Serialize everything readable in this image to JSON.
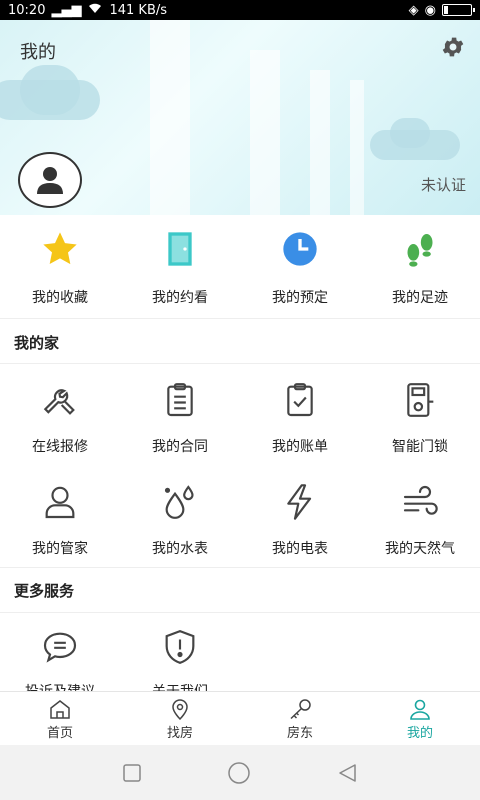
{
  "status_bar": {
    "time": "10:20",
    "speed": "141 KB/s"
  },
  "header": {
    "title": "我的",
    "cert_status": "未认证"
  },
  "quick_actions": [
    {
      "label": "我的收藏",
      "icon": "star-icon",
      "color": "#f5c518"
    },
    {
      "label": "我的约看",
      "icon": "door-icon",
      "color": "#3cc8c8"
    },
    {
      "label": "我的预定",
      "icon": "clock-icon",
      "color": "#3a8ee6"
    },
    {
      "label": "我的足迹",
      "icon": "footprint-icon",
      "color": "#4caf50"
    }
  ],
  "home_section": {
    "title": "我的家",
    "items": [
      {
        "label": "在线报修",
        "icon": "wrench-icon"
      },
      {
        "label": "我的合同",
        "icon": "contract-icon"
      },
      {
        "label": "我的账单",
        "icon": "bill-icon"
      },
      {
        "label": "智能门锁",
        "icon": "smart-lock-icon"
      },
      {
        "label": "我的管家",
        "icon": "person-icon"
      },
      {
        "label": "我的水表",
        "icon": "water-drop-icon"
      },
      {
        "label": "我的电表",
        "icon": "lightning-icon"
      },
      {
        "label": "我的天然气",
        "icon": "gas-wind-icon"
      }
    ]
  },
  "more_section": {
    "title": "更多服务",
    "items": [
      {
        "label": "投诉及建议",
        "icon": "chat-bubble-icon"
      },
      {
        "label": "关于我们",
        "icon": "shield-icon"
      }
    ]
  },
  "tabbar": {
    "tabs": [
      {
        "label": "首页",
        "icon": "home-icon"
      },
      {
        "label": "找房",
        "icon": "location-pin-icon"
      },
      {
        "label": "房东",
        "icon": "key-icon"
      },
      {
        "label": "我的",
        "icon": "user-icon"
      }
    ],
    "active_color": "#1aa6a0"
  }
}
